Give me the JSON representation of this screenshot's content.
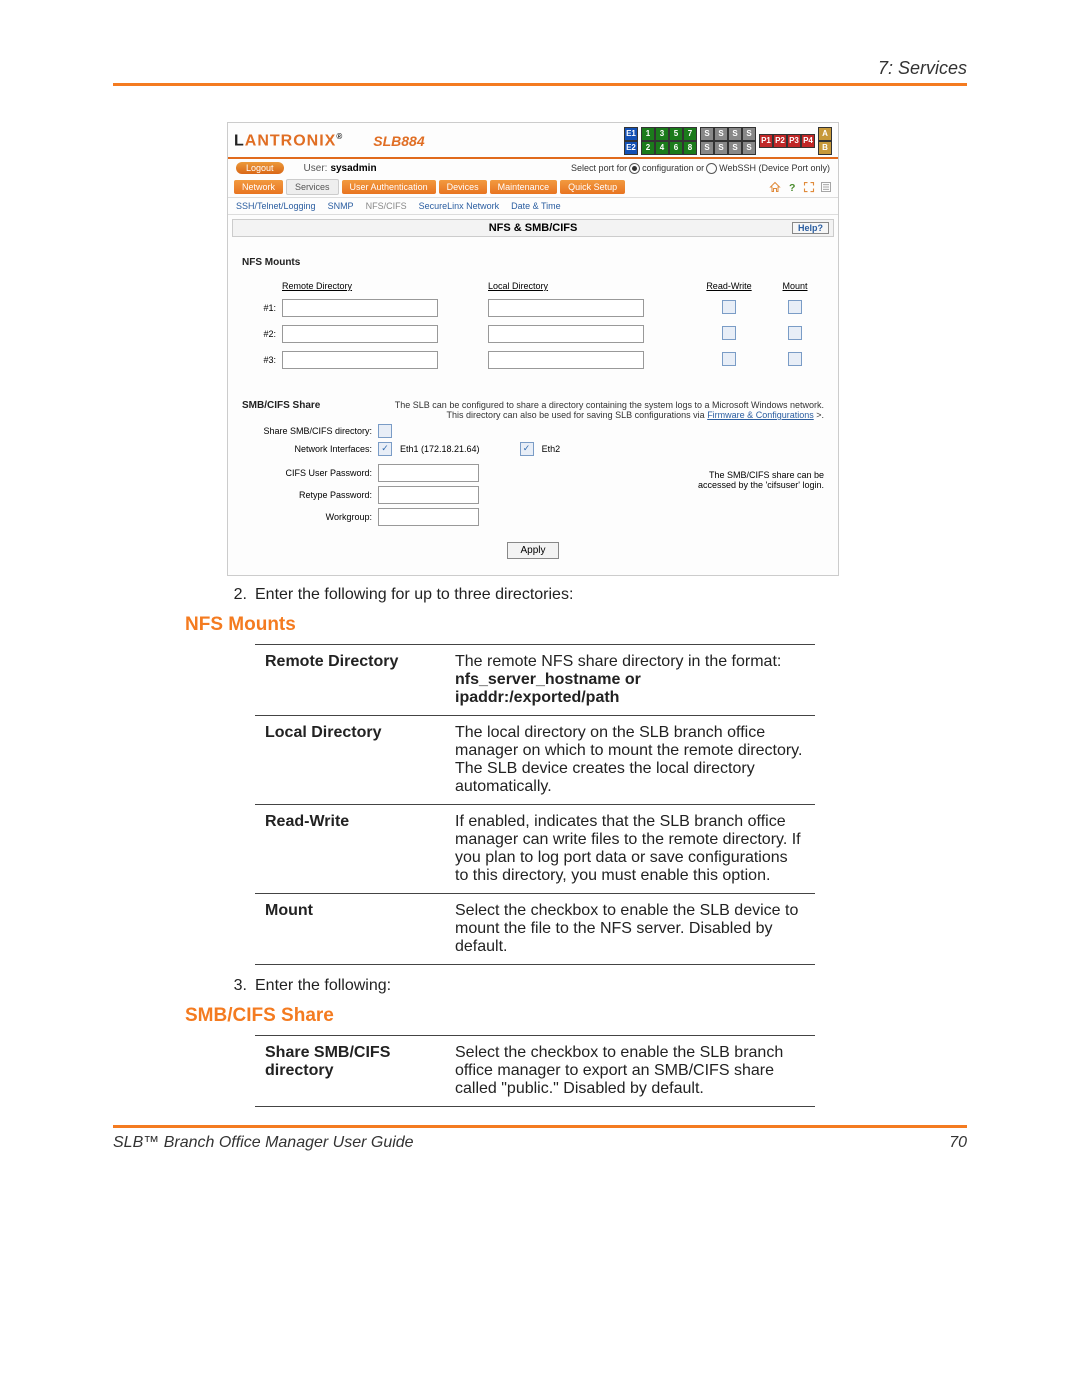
{
  "doc": {
    "header_title": "7: Services",
    "footer_left": "SLB™ Branch Office Manager User Guide",
    "footer_right": "70"
  },
  "app": {
    "logo_text_1": "L",
    "logo_text_2": "ANTRONIX",
    "logo_suffix": "®",
    "model": "SLB884",
    "e_labels": [
      "E1",
      "E2"
    ],
    "num_cells": [
      "1",
      "3",
      "5",
      "7",
      "2",
      "4",
      "6",
      "8"
    ],
    "s_cells": [
      "S",
      "S",
      "S",
      "S",
      "S",
      "S",
      "S",
      "S"
    ],
    "p_cells": [
      "P1",
      "P2",
      "P3",
      "P4"
    ],
    "ab_cells": [
      "A",
      "B"
    ],
    "logout": "Logout",
    "user_label": "User:",
    "user_value": "sysadmin",
    "port_prefix": "Select port for",
    "port_conf": "configuration or",
    "port_ssh": "WebSSH (Device Port only)",
    "tabs": [
      "Network",
      "Services",
      "User Authentication",
      "Devices",
      "Maintenance",
      "Quick Setup"
    ],
    "subtabs": [
      "SSH/Telnet/Logging",
      "SNMP",
      "NFS/CIFS",
      "SecureLinx Network",
      "Date & Time"
    ],
    "panel_title": "NFS & SMB/CIFS",
    "help_label": "Help?",
    "nfs_section": "NFS Mounts",
    "col_remote": "Remote Directory",
    "col_local": "Local Directory",
    "col_rw": "Read-Write",
    "col_mount": "Mount",
    "rows": [
      "#1:",
      "#2:",
      "#3:"
    ],
    "smb_section": "SMB/CIFS Share",
    "smb_note1": "The SLB can be configured to share a directory containing the system logs to a Microsoft Windows network.",
    "smb_note2_a": "This directory can also be used for saving SLB configurations via ",
    "smb_note2_link": "Firmware & Configurations",
    "share_dir_label": "Share SMB/CIFS directory:",
    "netif_label": "Network Interfaces:",
    "eth1": "Eth1 (172.18.21.64)",
    "eth2": "Eth2",
    "cifs_pw_label": "CIFS User Password:",
    "retype_pw_label": "Retype Password:",
    "workgroup_label": "Workgroup:",
    "share_note1": "The SMB/CIFS share can be",
    "share_note2": "accessed by the 'cifsuser' login.",
    "apply": "Apply"
  },
  "doc_body": {
    "step2": "Enter the following for up to three directories:",
    "nfs_title": "NFS Mounts",
    "rows": [
      {
        "k": "Remote Directory",
        "v_a": "The remote NFS share directory in the format:",
        "v_b": "nfs_server_hostname or ipaddr:/exported/path"
      },
      {
        "k": "Local Directory",
        "v": "The local directory on the SLB branch office manager on which to mount the remote directory. The SLB device creates the local directory automatically."
      },
      {
        "k": "Read-Write",
        "v": "If enabled, indicates that the SLB branch office manager can write files to the remote directory. If you plan to log port data or save configurations to this directory, you must enable this option."
      },
      {
        "k": "Mount",
        "v": "Select the checkbox to enable the SLB device to mount the file to the NFS server. Disabled by default."
      }
    ],
    "step3": "Enter the following:",
    "smb_title": "SMB/CIFS Share",
    "smb_rows": [
      {
        "k": "Share SMB/CIFS directory",
        "v": "Select the checkbox to enable the SLB branch office manager to export an SMB/CIFS share called \"public.\" Disabled by default."
      }
    ]
  }
}
